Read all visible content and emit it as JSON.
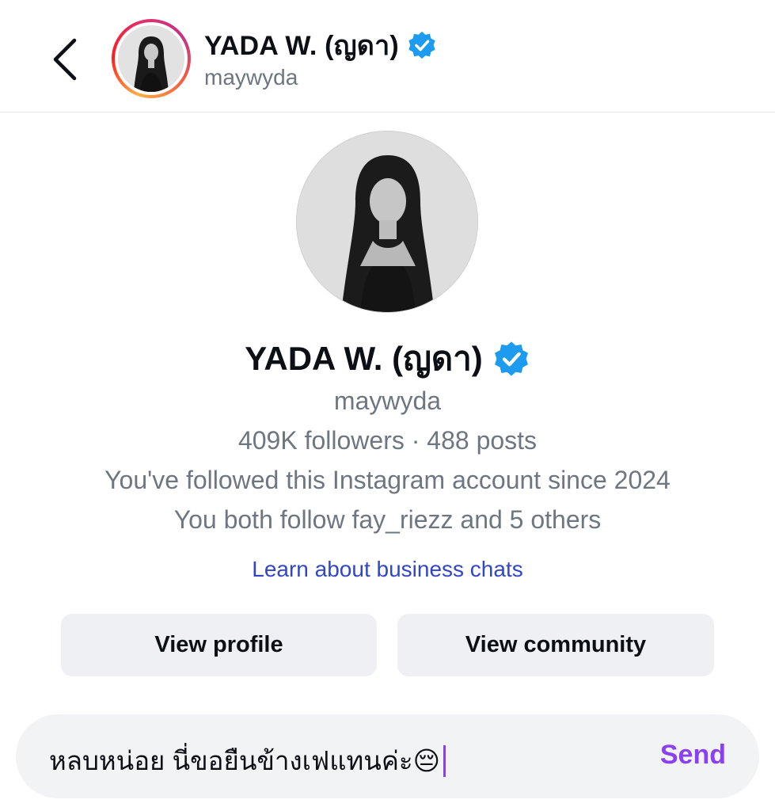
{
  "header": {
    "back_icon": "chevron-left-icon",
    "display_name": "YADA W. (ญดา)",
    "username": "maywyda",
    "verified_icon": "verified-badge-icon",
    "avatar_ring_colors": [
      "#fcaf45",
      "#fd1d1d",
      "#e1306c",
      "#c13584"
    ]
  },
  "profile": {
    "display_name": "YADA W. (ญดา)",
    "verified_icon": "verified-badge-icon",
    "username": "maywyda",
    "stats": "409K followers · 488 posts",
    "following_since": "You've followed this Instagram account since 2024",
    "mutual": "You both follow fay_riezz and 5 others",
    "business_link": "Learn about business chats"
  },
  "actions": {
    "view_profile": "View profile",
    "view_community": "View community"
  },
  "composer": {
    "value": "หลบหน่อย นี่ขอยืนข้างเฟแทนค่ะ😔",
    "send_label": "Send"
  },
  "colors": {
    "verified": "#1d9bf0",
    "link": "#3246c8",
    "send": "#8a3ff0",
    "button_bg": "#eef0f3",
    "composer_bg": "#f2f3f5",
    "secondary_text": "#6e7681"
  }
}
